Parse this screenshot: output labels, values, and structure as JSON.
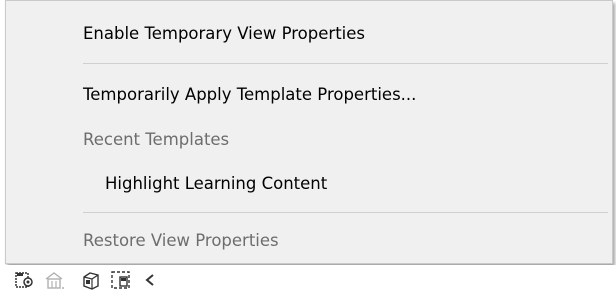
{
  "menu": {
    "items": [
      {
        "label": "Enable Temporary View Properties",
        "enabled": true
      },
      {
        "label": "Temporarily Apply Template Properties...",
        "enabled": true
      },
      {
        "label": "Recent Templates",
        "enabled": false
      },
      {
        "label": "Highlight Learning Content",
        "enabled": true
      },
      {
        "label": "Restore View Properties",
        "enabled": false
      }
    ]
  },
  "toolbar": {
    "icons": [
      "temporary-view-properties-icon",
      "show-hidden-elements-icon",
      "analytical-model-icon",
      "crop-region-icon",
      "collapse-arrow-icon"
    ]
  }
}
